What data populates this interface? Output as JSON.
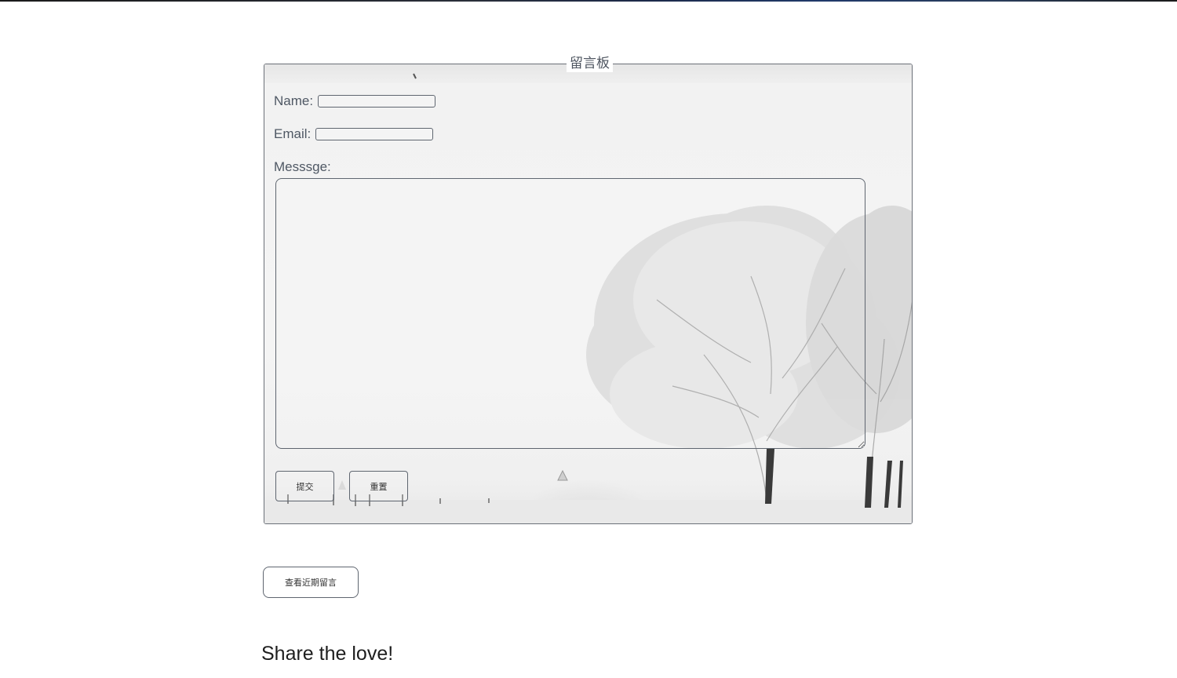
{
  "guestbook": {
    "legend": "留言板",
    "name_label": "Name:",
    "email_label": "Email:",
    "message_label": "Messsge:",
    "submit_label": "提交",
    "reset_label": "重置"
  },
  "recent_messages_button": "查看近期留言",
  "share_heading": "Share the love!",
  "icons": {
    "background": "snowy-tree-background-image"
  }
}
